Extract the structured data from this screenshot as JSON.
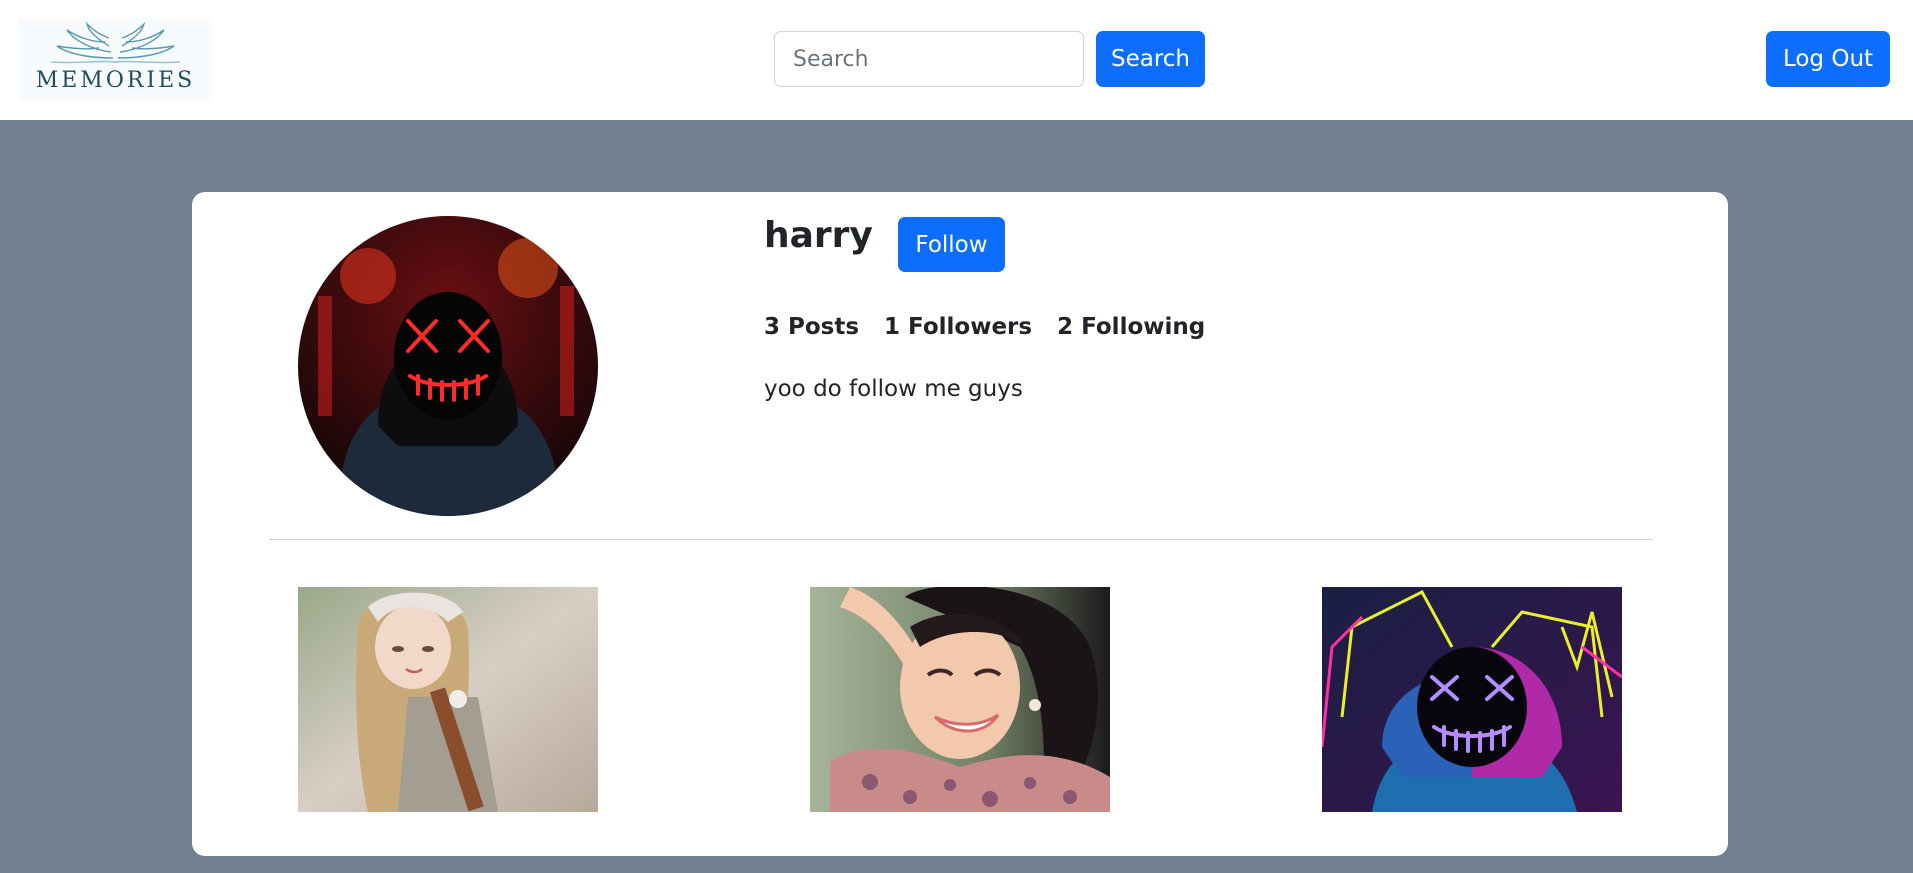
{
  "navbar": {
    "logo_text": "MEMORIES",
    "search_placeholder": "Search",
    "search_button": "Search",
    "logout_button": "Log Out"
  },
  "profile": {
    "username": "harry",
    "follow_button": "Follow",
    "stats": {
      "posts": "3 Posts",
      "followers": "1 Followers",
      "following": "2 Following"
    },
    "bio": "yoo do follow me guys",
    "avatar_icon": "neon-mask-hoodie-photo"
  },
  "posts": [
    {
      "icon": "doll-photo"
    },
    {
      "icon": "smiling-woman-photo"
    },
    {
      "icon": "neon-mask-hoodie-photo"
    }
  ],
  "colors": {
    "page_background": "#708090",
    "primary_button": "#0d6efd",
    "card_background": "#ffffff"
  }
}
